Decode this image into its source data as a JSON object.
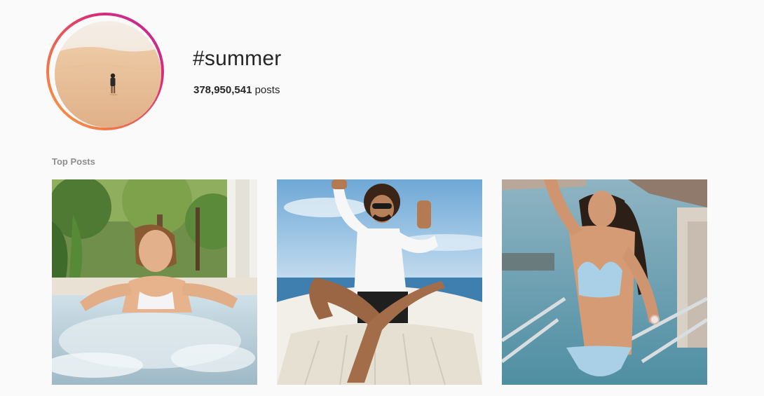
{
  "header": {
    "hashtag": "#summer",
    "post_count": "378,950,541",
    "post_count_suffix": "posts",
    "avatar_icon": "hashtag-cover-photo-desert-person"
  },
  "sections": {
    "top_posts_label": "Top Posts"
  },
  "top_posts": [
    {
      "icon": "photo-girl-in-hot-tub"
    },
    {
      "icon": "photo-man-on-boat-framing-hands"
    },
    {
      "icon": "photo-woman-in-blue-bikini-by-sea"
    }
  ],
  "colors": {
    "background": "#fafafa",
    "text": "#262626",
    "muted": "#8e8e8e",
    "ring_start": "#f9a03f",
    "ring_end": "#c0269d"
  }
}
